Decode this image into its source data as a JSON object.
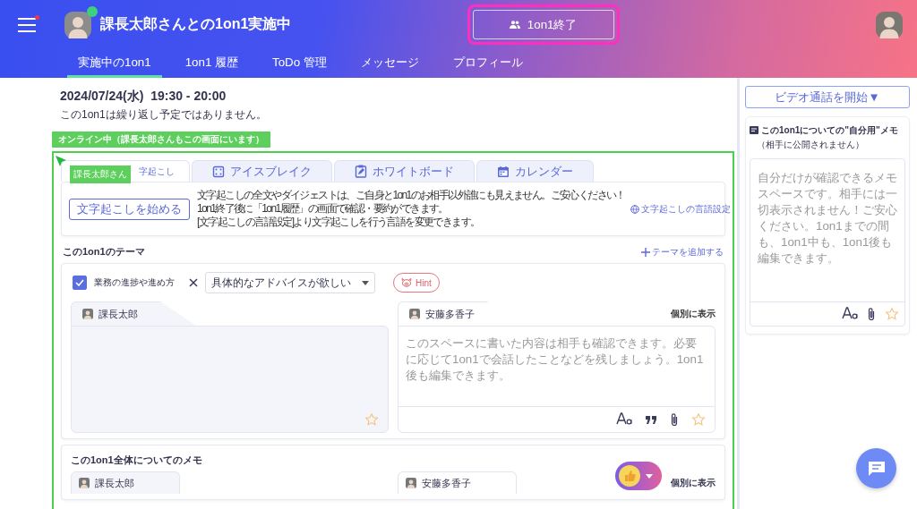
{
  "header": {
    "title": "課長太郎さんとの1on1実施中",
    "notification": true,
    "online": true,
    "end_button": "1on1終了",
    "highlight": true
  },
  "nav": [
    {
      "label": "実施中の1on1",
      "selected": true
    },
    {
      "label": "1on1 履歴",
      "selected": false
    },
    {
      "label": "ToDo 管理",
      "selected": false
    },
    {
      "label": "メッセージ",
      "selected": false
    },
    {
      "label": "プロフィール",
      "selected": false
    }
  ],
  "session": {
    "date": "2024/07/24(水)  19:30 - 20:00",
    "note": "この1on1は繰り返し予定ではありません。",
    "presence": "オンライン中（課長太郎さんもこの画面にいます）",
    "cursor_label": "課長太郎さん"
  },
  "tool_tabs": [
    {
      "label": "字起こし",
      "selected": true
    },
    {
      "label": "アイスブレイク",
      "selected": false
    },
    {
      "label": "ホワイトボード",
      "selected": false
    },
    {
      "label": "カレンダー",
      "selected": false
    }
  ],
  "transcription": {
    "button": "文字起こしを始める",
    "lines": [
      "文字起こしの全文やダイジェストは、ご自身と1on1のお相手以外誰にも見えません。ご安心ください！",
      "1on1終了後に「1on1履歴」の画面で確認・要約ができます。",
      "[文字起こしの言語設定]より文字起こしを行う言語を変更できます。"
    ],
    "language_link": "文字起こしの言語設定"
  },
  "theme": {
    "heading": "この1on1のテーマ",
    "add_link": "テーマを追加する",
    "topic": {
      "checked": true,
      "label": "業務の進捗や進め方"
    },
    "select_value": "具体的なアドバイスが欲しい",
    "hint": "Hint",
    "notes": [
      {
        "author": "課長太郎",
        "editable": false
      },
      {
        "author": "安藤多香子",
        "editable": true,
        "toggle": "個別に表示",
        "placeholder": "このスペースに書いた内容は相手も確認できます。必要に応じて1on1で会話したことなどを残しましょう。1on1後も編集できます。"
      }
    ]
  },
  "overall_memo": {
    "heading": "この1on1全体についてのメモ",
    "authors": [
      "課長太郎",
      "安藤多香子"
    ],
    "toggle": "個別に表示"
  },
  "sidebar": {
    "video_button": "ビデオ通話を開始▼",
    "memo_title": "この1on1についての\"自分用\"メモ",
    "memo_subtitle": "（相手に公開されません）",
    "memo_placeholder": "自分だけが確認できるメモスペースです。相手には一切表示されません！ご安心ください。1on1までの間も、1on1中も、1on1後も編集できます。"
  }
}
